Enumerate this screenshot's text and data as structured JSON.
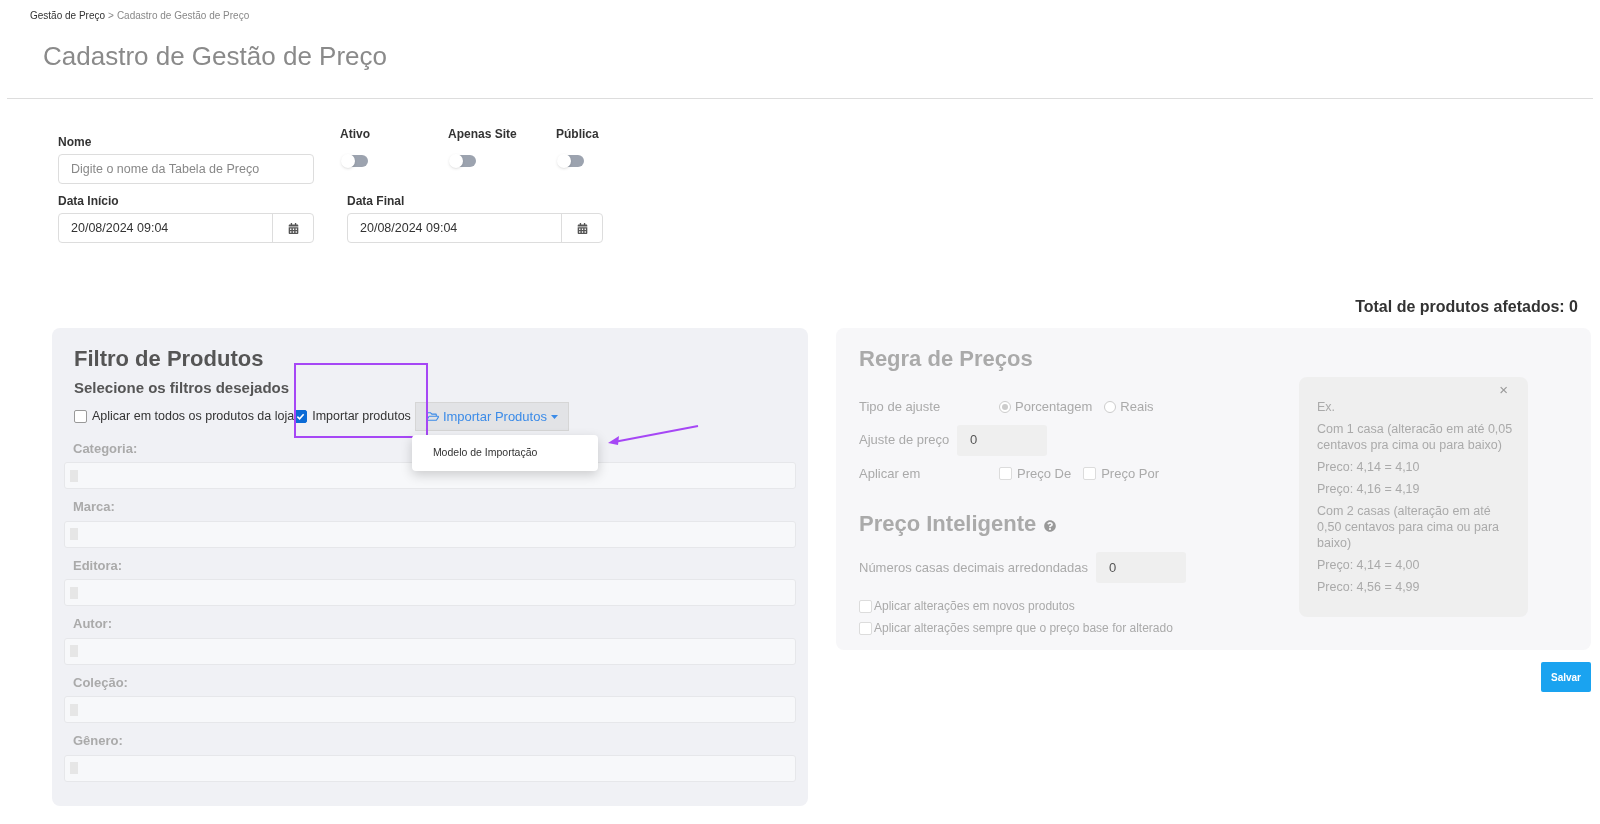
{
  "breadcrumb": {
    "parent": "Gestão de Preço",
    "separator": ">",
    "current": "Cadastro de Gestão de Preço"
  },
  "page_title": "Cadastro de Gestão de Preço",
  "form": {
    "nome": {
      "label": "Nome",
      "placeholder": "Digite o nome da Tabela de Preço"
    },
    "toggles": [
      {
        "label": "Ativo",
        "on": false
      },
      {
        "label": "Apenas Site",
        "on": false
      },
      {
        "label": "Pública",
        "on": false
      }
    ],
    "dates": [
      {
        "label": "Data Início",
        "value": "20/08/2024 09:04"
      },
      {
        "label": "Data Final",
        "value": "20/08/2024 09:04"
      }
    ]
  },
  "total_label": "Total de produtos afetados: 0",
  "filter_panel": {
    "title": "Filtro de Produtos",
    "subtitle": "Selecione os filtros desejados",
    "apply_all": {
      "label": "Aplicar em todos os produtos da loja",
      "checked": false
    },
    "import_check": {
      "label": "Importar produtos",
      "checked": true
    },
    "import_button": {
      "label": "Importar Produtos",
      "expanded": true,
      "menu": [
        "Modelo de Importação"
      ]
    },
    "filters": [
      {
        "label": "Categoria:"
      },
      {
        "label": "Marca:"
      },
      {
        "label": "Editora:"
      },
      {
        "label": "Autor:"
      },
      {
        "label": "Coleção:"
      },
      {
        "label": "Gênero:"
      }
    ]
  },
  "rules_panel": {
    "title": "Regra de Preços",
    "tipo": {
      "label": "Tipo de ajuste",
      "options": [
        {
          "label": "Porcentagem",
          "selected": true
        },
        {
          "label": "Reais",
          "selected": false
        }
      ]
    },
    "ajuste": {
      "label": "Ajuste de preço",
      "value": "0"
    },
    "aplicar": {
      "label": "Aplicar em",
      "options": [
        {
          "label": "Preço De",
          "checked": false
        },
        {
          "label": "Preço Por",
          "checked": false
        }
      ]
    },
    "smart_title": "Preço Inteligente",
    "decimais": {
      "label": "Números casas decimais arredondadas",
      "value": "0"
    },
    "checks": [
      {
        "label": "Aplicar alterações em novos produtos",
        "checked": false
      },
      {
        "label": "Aplicar alterações sempre que o preço base for alterado",
        "checked": false
      }
    ],
    "example": {
      "close": "×",
      "lines": [
        "Ex.",
        "Com 1 casa (alteracão em até 0,05 centavos pra cima ou para baixo)",
        "Preco: 4,14 = 4,10",
        "Preço: 4,16 = 4,19",
        "Com 2 casas (alteração em até 0,50 centavos para cima ou para baixo)",
        "Preço: 4,14 = 4,00",
        "Preco: 4,56 = 4,99"
      ]
    }
  },
  "save_button": "Salvar"
}
